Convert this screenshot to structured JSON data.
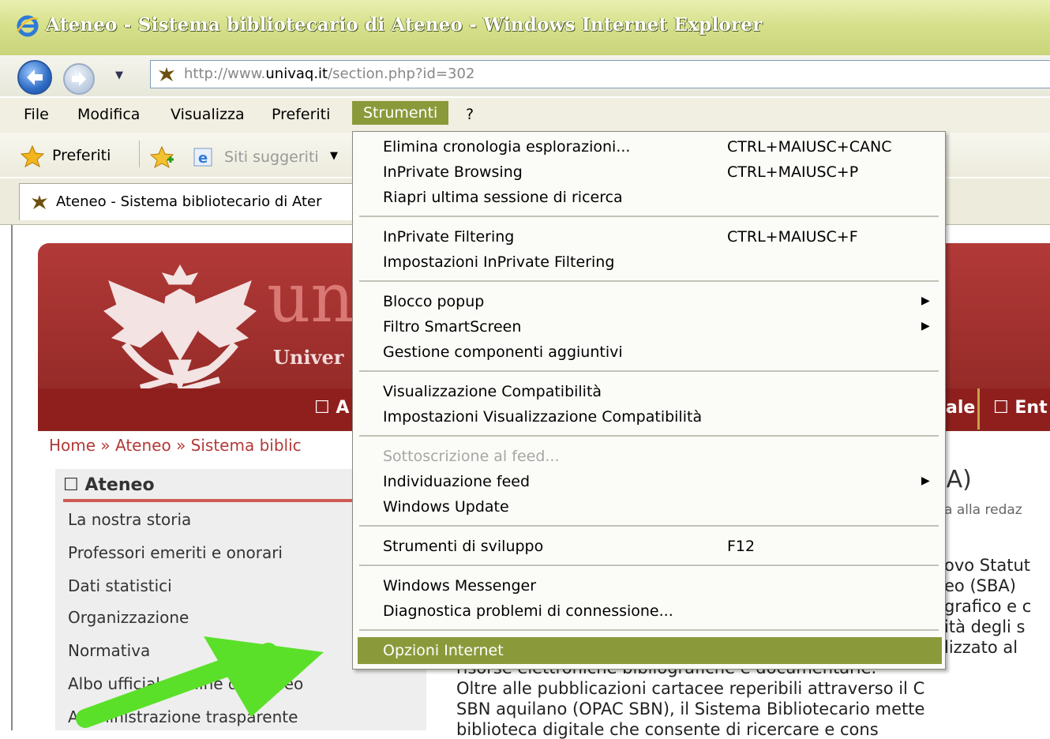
{
  "window": {
    "title": "Ateneo - Sistema bibliotecario di Ateneo - Windows Internet Explorer"
  },
  "address": {
    "url_prefix": "http://www.",
    "url_domain": "univaq.it",
    "url_path": "/section.php?id=302"
  },
  "menubar": {
    "items": [
      "File",
      "Modifica",
      "Visualizza",
      "Preferiti",
      "Strumenti",
      "?"
    ]
  },
  "favorites_bar": {
    "favorites_label": "Preferiti",
    "suggested_label": "Siti suggeriti"
  },
  "tab": {
    "title": "Ateneo - Sistema bibliotecario di Ater"
  },
  "site": {
    "logo_partial": "un",
    "univ_partial": "Univer",
    "nav_left": "A",
    "nav_right_1": "ale",
    "nav_right_2": "Ent",
    "breadcrumb": "Home » Ateneo » Sistema biblic",
    "sidebar_heading": "Ateneo",
    "sidebar_items": [
      "La nostra storia",
      "Professori emeriti e onorari",
      "Dati statistici",
      "Organizzazione",
      "Normativa",
      "Albo ufficiale online di Ateneo",
      "Amministrazione trasparente"
    ],
    "heading_partial": "BA)",
    "subhead_partial": "a alla redaz",
    "body_lines_right": [
      "ovo Statut",
      "eo (SBA)",
      "grafico e c",
      "ità degli s",
      "lizzato al"
    ],
    "body_lines_full": [
      "risorse elettroniche bibliografiche e documentarie.",
      "Oltre alle pubblicazioni cartacee reperibili attraverso il C",
      "SBN aquilano (OPAC SBN), il Sistema Bibliotecario mette",
      "biblioteca digitale che consente di ricercare e cons"
    ]
  },
  "tools_menu": {
    "groups": [
      [
        {
          "label": "Elimina cronologia esplorazioni...",
          "shortcut": "CTRL+MAIUSC+CANC"
        },
        {
          "label": "InPrivate Browsing",
          "shortcut": "CTRL+MAIUSC+P"
        },
        {
          "label": "Riapri ultima sessione di ricerca",
          "shortcut": ""
        }
      ],
      [
        {
          "label": "InPrivate Filtering",
          "shortcut": "CTRL+MAIUSC+F"
        },
        {
          "label": "Impostazioni InPrivate Filtering",
          "shortcut": ""
        }
      ],
      [
        {
          "label": "Blocco popup",
          "submenu": true
        },
        {
          "label": "Filtro SmartScreen",
          "submenu": true
        },
        {
          "label": "Gestione componenti aggiuntivi"
        }
      ],
      [
        {
          "label": "Visualizzazione Compatibilità"
        },
        {
          "label": "Impostazioni Visualizzazione Compatibilità"
        }
      ],
      [
        {
          "label": "Sottoscrizione al feed...",
          "disabled": true
        },
        {
          "label": "Individuazione feed",
          "submenu": true
        },
        {
          "label": "Windows Update"
        }
      ],
      [
        {
          "label": "Strumenti di sviluppo",
          "shortcut": "F12"
        }
      ],
      [
        {
          "label": "Windows Messenger"
        },
        {
          "label": "Diagnostica problemi di connessione..."
        }
      ],
      [
        {
          "label": "Opzioni Internet",
          "highlighted": true
        }
      ]
    ]
  },
  "colors": {
    "menu_highlight": "#8a9a3a",
    "banner_red": "#9e2d2b",
    "annotation_arrow": "#5be02a"
  }
}
